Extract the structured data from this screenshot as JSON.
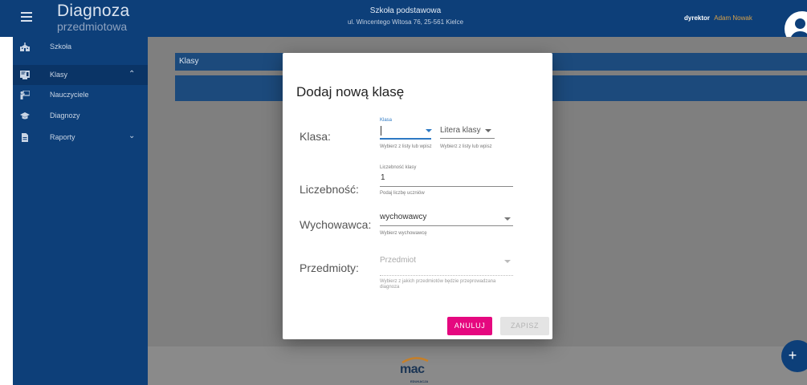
{
  "header": {
    "logo_title": "Diagnoza",
    "logo_subtitle": "przedmiotowa",
    "school_name": "Szkoła podstawowa",
    "school_address": "ul. Wincentego Witosa 76, 25-561 Kielce",
    "user_role": "dyrektor",
    "user_name": "Adam Nowak"
  },
  "sidebar": {
    "items": [
      {
        "label": "Szkoła",
        "icon": "school-icon"
      },
      {
        "label": "Klasy",
        "icon": "classroom-icon",
        "active": true,
        "chevron": "up"
      },
      {
        "label": "Nauczyciele",
        "icon": "teacher-icon"
      },
      {
        "label": "Diagnozy",
        "icon": "graduation-cap-icon"
      },
      {
        "label": "Raporty",
        "icon": "document-icon",
        "chevron": "down"
      }
    ]
  },
  "main": {
    "section_title": "Klasy"
  },
  "dialog": {
    "title": "Dodaj nową klasę",
    "klasa": {
      "label": "Klasa:",
      "class_field": {
        "float_label": "Klasa",
        "value": "",
        "hint": "Wybierz z listy lub wpisz"
      },
      "letter_field": {
        "placeholder": "Litera klasy",
        "hint": "Wybierz z listy lub wpisz"
      }
    },
    "liczebnosc": {
      "label": "Liczebność:",
      "float_label": "Liczebność klasy",
      "value": "1",
      "hint": "Podaj liczbę uczniów"
    },
    "wychowawca": {
      "label": "Wychowawca:",
      "value": "wychowawcy",
      "hint": "Wybierz wychowawcę"
    },
    "przedmioty": {
      "label": "Przedmioty:",
      "placeholder": "Przedmiot",
      "hint": "Wybierz z jakich przedmiotów będzie przeprowadzana diagnoza"
    },
    "cancel_label": "ANULUJ",
    "save_label": "ZAPISZ"
  },
  "footer": {
    "brand": "mac",
    "brand_sub": "EDUKACJA"
  },
  "fab_label": "+",
  "colors": {
    "primary": "#0d3f79",
    "accent": "#e5087f",
    "focus": "#2d79c4",
    "user_name": "#d9a24a"
  }
}
